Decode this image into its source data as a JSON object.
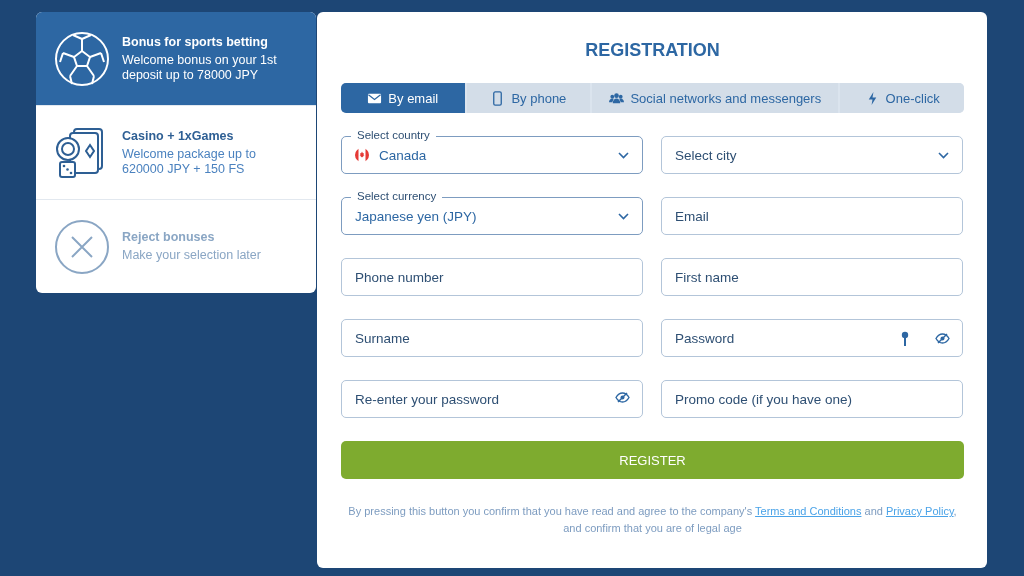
{
  "bonuses": [
    {
      "kind": "sports",
      "title": "Bonus for sports betting",
      "description": "Welcome bonus on your 1st deposit up to 78000 JPY",
      "selected": true
    },
    {
      "kind": "casino",
      "title": "Casino + 1xGames",
      "description": "Welcome package up to 620000 JPY + 150 FS",
      "selected": false
    },
    {
      "kind": "reject",
      "title": "Reject bonuses",
      "description": "Make your selection later",
      "selected": false
    }
  ],
  "registration": {
    "title": "REGISTRATION",
    "tabs": [
      {
        "kind": "email",
        "label": "By email",
        "selected": true
      },
      {
        "kind": "phone",
        "label": "By phone",
        "selected": false
      },
      {
        "kind": "social",
        "label": "Social networks and messengers",
        "selected": false
      },
      {
        "kind": "oneclick",
        "label": "One-click",
        "selected": false
      }
    ],
    "fields": [
      {
        "kind": "country-select",
        "label": "Select country",
        "value": "Canada"
      },
      {
        "kind": "select",
        "placeholder": "Select city"
      },
      {
        "kind": "select",
        "label": "Select currency",
        "value": "Japanese yen (JPY)"
      },
      {
        "kind": "text",
        "placeholder": "Email"
      },
      {
        "kind": "text",
        "placeholder": "Phone number"
      },
      {
        "kind": "text",
        "placeholder": "First name"
      },
      {
        "kind": "text",
        "placeholder": "Surname"
      },
      {
        "kind": "password",
        "placeholder": "Password",
        "key_hint": true
      },
      {
        "kind": "password",
        "placeholder": "Re-enter your password",
        "key_hint": false
      },
      {
        "kind": "text",
        "placeholder": "Promo code (if you have one)"
      }
    ],
    "submit": "REGISTER",
    "legal": [
      {
        "kind": "text",
        "text": "By pressing this button you confirm that you have read and agree to the company's "
      },
      {
        "kind": "link",
        "text": "Terms and Conditions"
      },
      {
        "kind": "text",
        "text": " and "
      },
      {
        "kind": "link",
        "text": "Privacy Policy"
      },
      {
        "kind": "text",
        "text": ", and confirm that you are of legal age"
      }
    ]
  }
}
